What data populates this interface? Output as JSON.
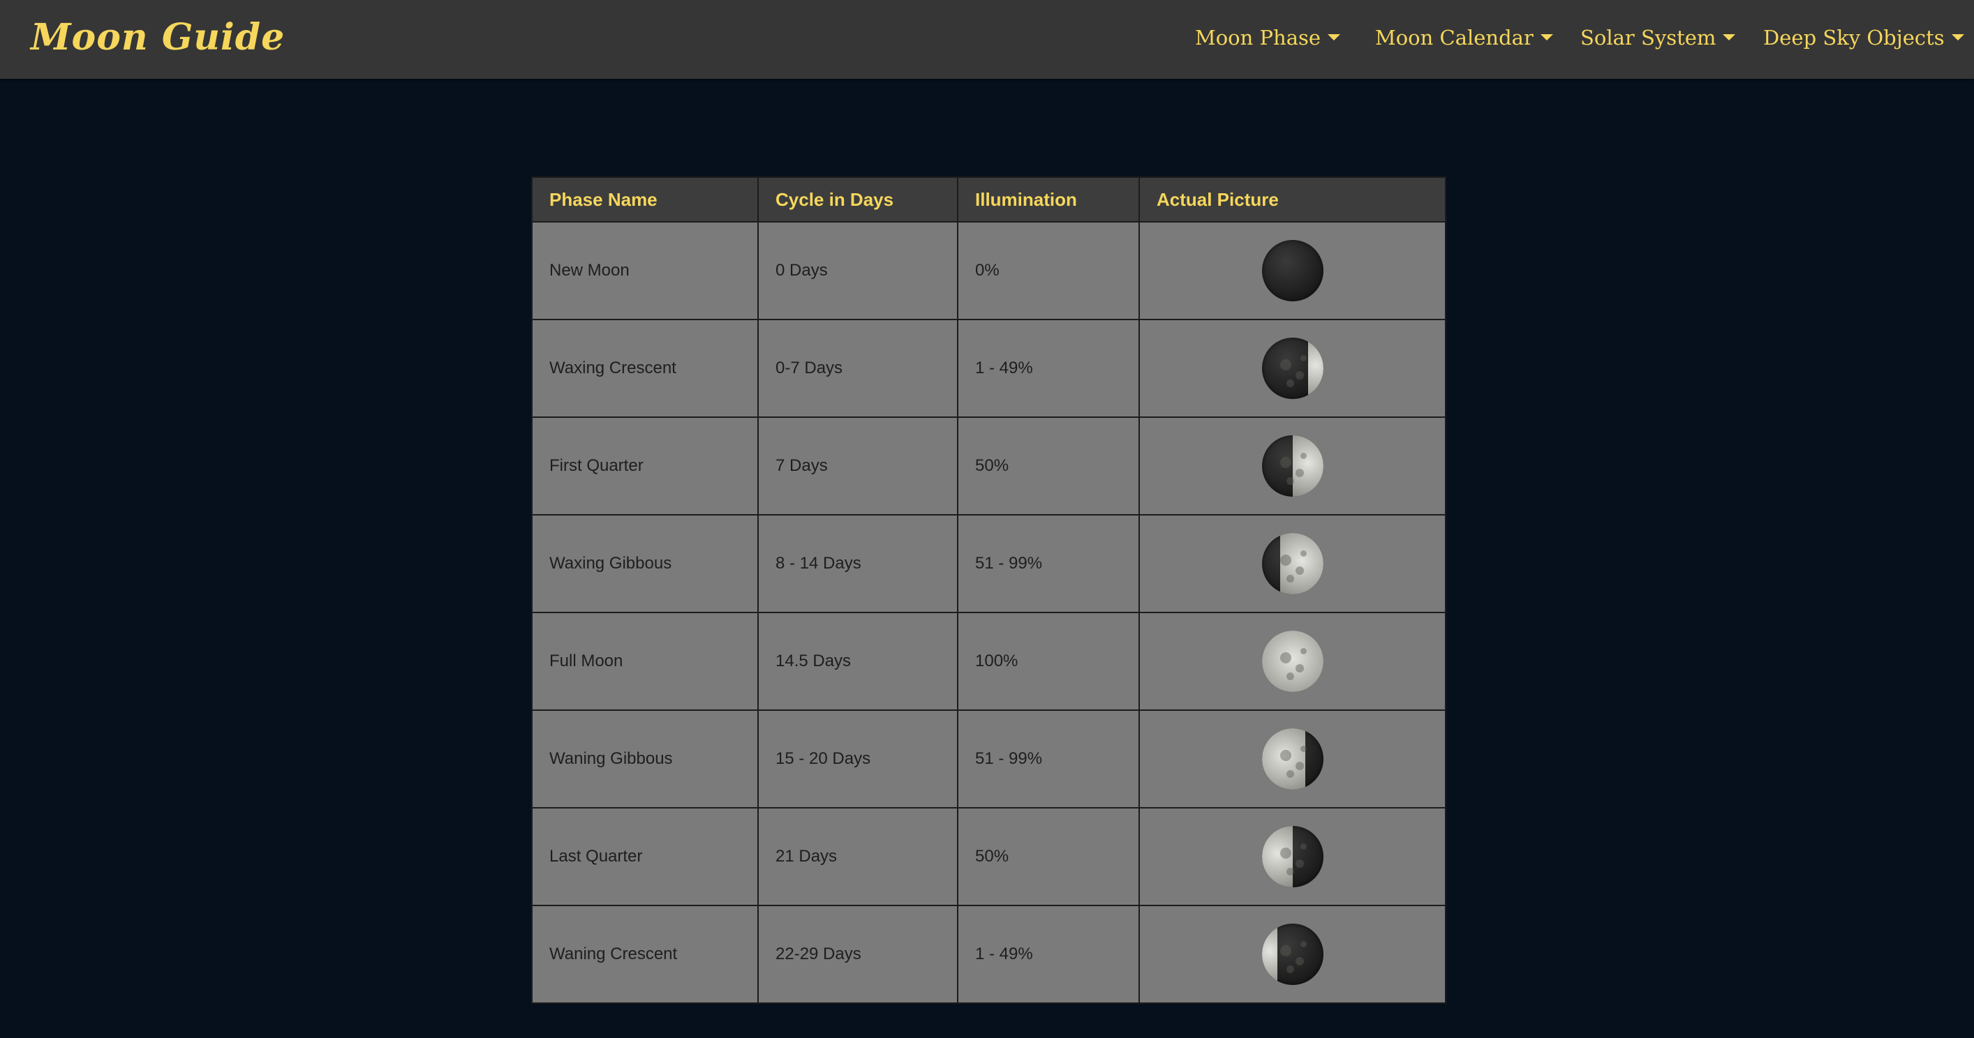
{
  "brand": {
    "title": "Moon Guide"
  },
  "nav": {
    "items": [
      {
        "label": "Moon Phase"
      },
      {
        "label": "Moon Calendar"
      },
      {
        "label": "Solar System"
      },
      {
        "label": "Deep Sky Objects"
      }
    ]
  },
  "table": {
    "headers": [
      "Phase Name",
      "Cycle in Days",
      "Illumination",
      "Actual Picture"
    ],
    "rows": [
      {
        "phase": "New Moon",
        "cycle": "0 Days",
        "illumination": "0%",
        "picture_icon": "new-moon-icon",
        "lit_fraction": 0.0,
        "lit_side": "none"
      },
      {
        "phase": "Waxing Crescent",
        "cycle": "0-7 Days",
        "illumination": "1 - 49%",
        "picture_icon": "waxing-crescent-icon",
        "lit_fraction": 0.25,
        "lit_side": "right"
      },
      {
        "phase": "First Quarter",
        "cycle": "7 Days",
        "illumination": "50%",
        "picture_icon": "first-quarter-icon",
        "lit_fraction": 0.5,
        "lit_side": "right"
      },
      {
        "phase": "Waxing Gibbous",
        "cycle": "8 - 14 Days",
        "illumination": "51 - 99%",
        "picture_icon": "waxing-gibbous-icon",
        "lit_fraction": 0.7,
        "lit_side": "right"
      },
      {
        "phase": "Full Moon",
        "cycle": "14.5 Days",
        "illumination": "100%",
        "picture_icon": "full-moon-icon",
        "lit_fraction": 1.0,
        "lit_side": "full"
      },
      {
        "phase": "Waning Gibbous",
        "cycle": "15 - 20 Days",
        "illumination": "51 - 99%",
        "picture_icon": "waning-gibbous-icon",
        "lit_fraction": 0.7,
        "lit_side": "left"
      },
      {
        "phase": "Last Quarter",
        "cycle": "21 Days",
        "illumination": "50%",
        "picture_icon": "last-quarter-icon",
        "lit_fraction": 0.5,
        "lit_side": "left"
      },
      {
        "phase": "Waning Crescent",
        "cycle": "22-29 Days",
        "illumination": "1 - 49%",
        "picture_icon": "waning-crescent-icon",
        "lit_fraction": 0.25,
        "lit_side": "left"
      }
    ]
  },
  "colors": {
    "page_background": "#06101d",
    "navbar_background": "#363636",
    "accent_yellow": "#f6d75c",
    "header_cell": "#3d3d3d",
    "body_cell": "#7b7b7b"
  }
}
